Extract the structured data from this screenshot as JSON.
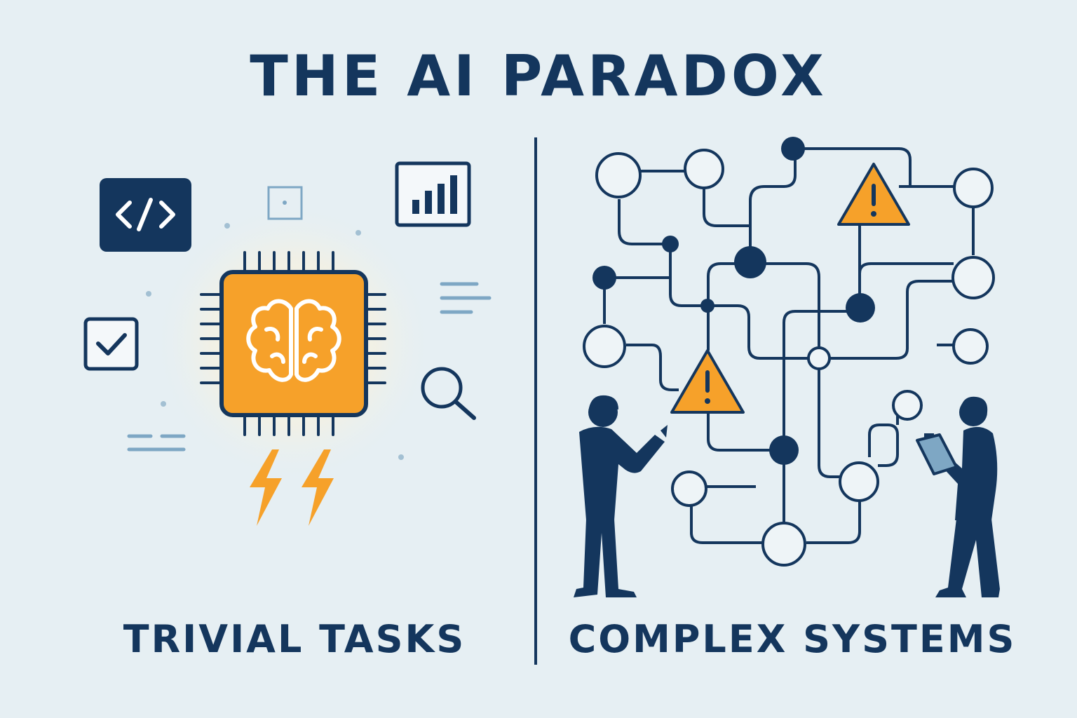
{
  "title": "THE AI PARADOX",
  "left": {
    "caption": "TRIVIAL TASKS"
  },
  "right": {
    "caption": "COMPLEX SYSTEMS"
  },
  "colors": {
    "navy": "#14365d",
    "orange": "#f6a12a",
    "background": "#e6eff3",
    "light_blue": "#7ea7c4"
  },
  "icons": [
    "code-icon",
    "bar-chart-icon",
    "checkbox-icon",
    "search-icon",
    "chip-icon",
    "brain-icon",
    "lightning-icon",
    "warning-icon",
    "person-icon",
    "clipboard-icon"
  ]
}
